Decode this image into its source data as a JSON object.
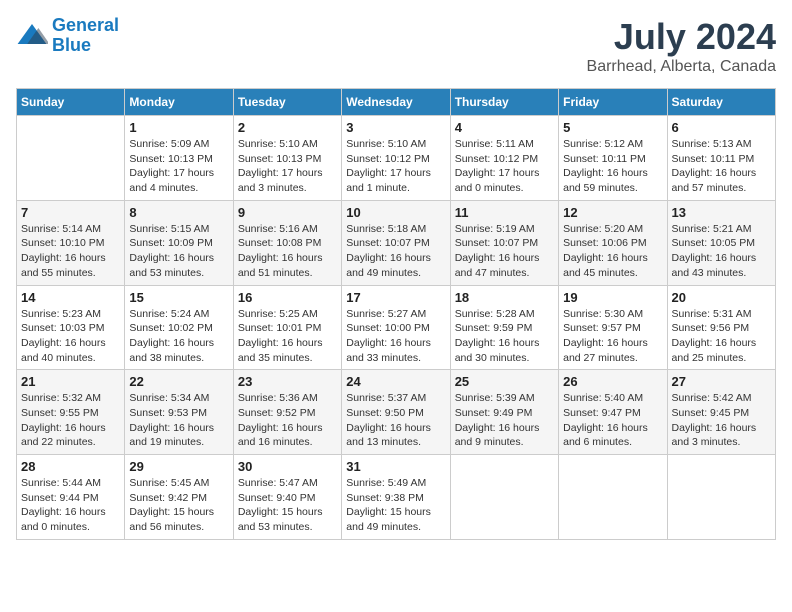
{
  "logo": {
    "text_general": "General",
    "text_blue": "Blue"
  },
  "title": "July 2024",
  "subtitle": "Barrhead, Alberta, Canada",
  "days_of_week": [
    "Sunday",
    "Monday",
    "Tuesday",
    "Wednesday",
    "Thursday",
    "Friday",
    "Saturday"
  ],
  "weeks": [
    [
      {
        "day": "",
        "info": ""
      },
      {
        "day": "1",
        "info": "Sunrise: 5:09 AM\nSunset: 10:13 PM\nDaylight: 17 hours\nand 4 minutes."
      },
      {
        "day": "2",
        "info": "Sunrise: 5:10 AM\nSunset: 10:13 PM\nDaylight: 17 hours\nand 3 minutes."
      },
      {
        "day": "3",
        "info": "Sunrise: 5:10 AM\nSunset: 10:12 PM\nDaylight: 17 hours\nand 1 minute."
      },
      {
        "day": "4",
        "info": "Sunrise: 5:11 AM\nSunset: 10:12 PM\nDaylight: 17 hours\nand 0 minutes."
      },
      {
        "day": "5",
        "info": "Sunrise: 5:12 AM\nSunset: 10:11 PM\nDaylight: 16 hours\nand 59 minutes."
      },
      {
        "day": "6",
        "info": "Sunrise: 5:13 AM\nSunset: 10:11 PM\nDaylight: 16 hours\nand 57 minutes."
      }
    ],
    [
      {
        "day": "7",
        "info": "Sunrise: 5:14 AM\nSunset: 10:10 PM\nDaylight: 16 hours\nand 55 minutes."
      },
      {
        "day": "8",
        "info": "Sunrise: 5:15 AM\nSunset: 10:09 PM\nDaylight: 16 hours\nand 53 minutes."
      },
      {
        "day": "9",
        "info": "Sunrise: 5:16 AM\nSunset: 10:08 PM\nDaylight: 16 hours\nand 51 minutes."
      },
      {
        "day": "10",
        "info": "Sunrise: 5:18 AM\nSunset: 10:07 PM\nDaylight: 16 hours\nand 49 minutes."
      },
      {
        "day": "11",
        "info": "Sunrise: 5:19 AM\nSunset: 10:07 PM\nDaylight: 16 hours\nand 47 minutes."
      },
      {
        "day": "12",
        "info": "Sunrise: 5:20 AM\nSunset: 10:06 PM\nDaylight: 16 hours\nand 45 minutes."
      },
      {
        "day": "13",
        "info": "Sunrise: 5:21 AM\nSunset: 10:05 PM\nDaylight: 16 hours\nand 43 minutes."
      }
    ],
    [
      {
        "day": "14",
        "info": "Sunrise: 5:23 AM\nSunset: 10:03 PM\nDaylight: 16 hours\nand 40 minutes."
      },
      {
        "day": "15",
        "info": "Sunrise: 5:24 AM\nSunset: 10:02 PM\nDaylight: 16 hours\nand 38 minutes."
      },
      {
        "day": "16",
        "info": "Sunrise: 5:25 AM\nSunset: 10:01 PM\nDaylight: 16 hours\nand 35 minutes."
      },
      {
        "day": "17",
        "info": "Sunrise: 5:27 AM\nSunset: 10:00 PM\nDaylight: 16 hours\nand 33 minutes."
      },
      {
        "day": "18",
        "info": "Sunrise: 5:28 AM\nSunset: 9:59 PM\nDaylight: 16 hours\nand 30 minutes."
      },
      {
        "day": "19",
        "info": "Sunrise: 5:30 AM\nSunset: 9:57 PM\nDaylight: 16 hours\nand 27 minutes."
      },
      {
        "day": "20",
        "info": "Sunrise: 5:31 AM\nSunset: 9:56 PM\nDaylight: 16 hours\nand 25 minutes."
      }
    ],
    [
      {
        "day": "21",
        "info": "Sunrise: 5:32 AM\nSunset: 9:55 PM\nDaylight: 16 hours\nand 22 minutes."
      },
      {
        "day": "22",
        "info": "Sunrise: 5:34 AM\nSunset: 9:53 PM\nDaylight: 16 hours\nand 19 minutes."
      },
      {
        "day": "23",
        "info": "Sunrise: 5:36 AM\nSunset: 9:52 PM\nDaylight: 16 hours\nand 16 minutes."
      },
      {
        "day": "24",
        "info": "Sunrise: 5:37 AM\nSunset: 9:50 PM\nDaylight: 16 hours\nand 13 minutes."
      },
      {
        "day": "25",
        "info": "Sunrise: 5:39 AM\nSunset: 9:49 PM\nDaylight: 16 hours\nand 9 minutes."
      },
      {
        "day": "26",
        "info": "Sunrise: 5:40 AM\nSunset: 9:47 PM\nDaylight: 16 hours\nand 6 minutes."
      },
      {
        "day": "27",
        "info": "Sunrise: 5:42 AM\nSunset: 9:45 PM\nDaylight: 16 hours\nand 3 minutes."
      }
    ],
    [
      {
        "day": "28",
        "info": "Sunrise: 5:44 AM\nSunset: 9:44 PM\nDaylight: 16 hours\nand 0 minutes."
      },
      {
        "day": "29",
        "info": "Sunrise: 5:45 AM\nSunset: 9:42 PM\nDaylight: 15 hours\nand 56 minutes."
      },
      {
        "day": "30",
        "info": "Sunrise: 5:47 AM\nSunset: 9:40 PM\nDaylight: 15 hours\nand 53 minutes."
      },
      {
        "day": "31",
        "info": "Sunrise: 5:49 AM\nSunset: 9:38 PM\nDaylight: 15 hours\nand 49 minutes."
      },
      {
        "day": "",
        "info": ""
      },
      {
        "day": "",
        "info": ""
      },
      {
        "day": "",
        "info": ""
      }
    ]
  ]
}
